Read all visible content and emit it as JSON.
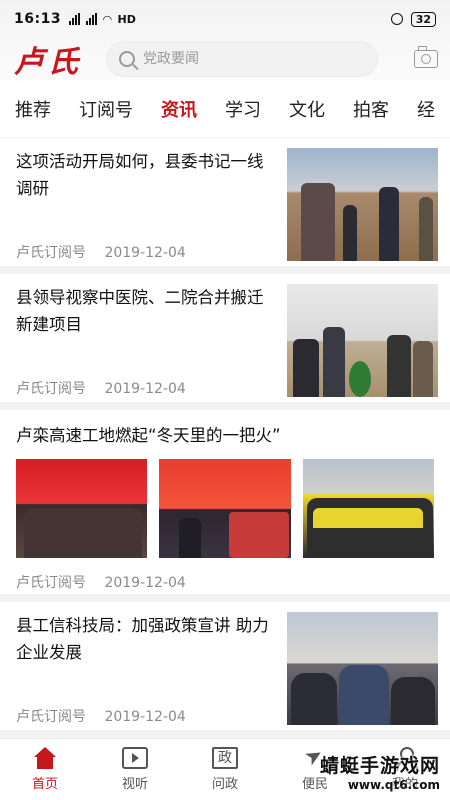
{
  "status_bar": {
    "time": "16:13",
    "signal_label": "HD",
    "battery": "32"
  },
  "header": {
    "logo": "卢氏",
    "search_placeholder": "党政要闻"
  },
  "tabs": [
    {
      "label": "推荐"
    },
    {
      "label": "订阅号"
    },
    {
      "label": "资讯"
    },
    {
      "label": "学习"
    },
    {
      "label": "文化"
    },
    {
      "label": "拍客"
    },
    {
      "label": "经"
    }
  ],
  "active_tab": "资讯",
  "articles": [
    {
      "title": "这项活动开局如何，县委书记一线调研",
      "source": "卢氏订阅号",
      "date": "2019-12-04"
    },
    {
      "title": "县领导视察中医院、二院合并搬迁新建项目",
      "source": "卢氏订阅号",
      "date": "2019-12-04"
    },
    {
      "title": "卢栾高速工地燃起“冬天里的一把火”",
      "source": "卢氏订阅号",
      "date": "2019-12-04"
    },
    {
      "title": "县工信科技局：加强政策宣讲 助力企业发展",
      "source": "卢氏订阅号",
      "date": "2019-12-04"
    }
  ],
  "bottom_nav": [
    {
      "label": "首页",
      "icon": "home-icon"
    },
    {
      "label": "视听",
      "icon": "tv-icon"
    },
    {
      "label": "问政",
      "icon": "zheng-icon",
      "glyph": "政"
    },
    {
      "label": "便民",
      "icon": "send-icon"
    },
    {
      "label": "我的",
      "icon": "user-icon"
    }
  ],
  "watermark": {
    "line1": "蜻蜓手游戏网",
    "line2": "www.qt6.com"
  },
  "colors": {
    "accent": "#c8161d",
    "meta_text": "#8a8a8a"
  }
}
